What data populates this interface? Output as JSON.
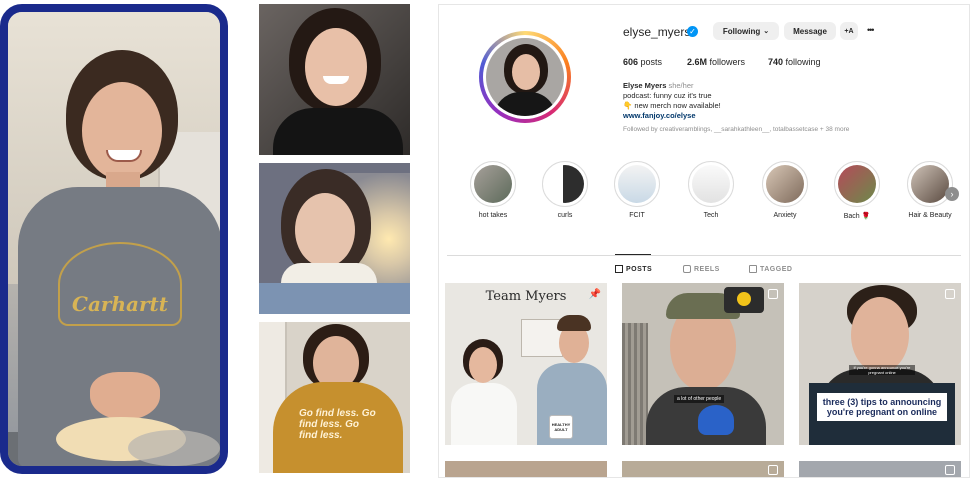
{
  "profile": {
    "username": "elyse_myers",
    "verified_icon": "verified-badge-icon",
    "following_label": "Following",
    "message_label": "Message",
    "add_person_glyph": "+A",
    "more_glyph": "•••",
    "posts_count": "606",
    "posts_label": "posts",
    "followers_count": "2.6M",
    "followers_label": "followers",
    "following_count": "740",
    "following_count_label": "following",
    "name": "Elyse Myers",
    "pronouns": "she/her",
    "bio_line1": "podcast: funny cuz it's true",
    "bio_line2": "👇 new merch now available!",
    "link": "www.fanjoy.co/elyse",
    "followed_by": "Followed by creativeramblings, __sarahkathleen__, totalbassetcase + 38 more"
  },
  "highlights": [
    {
      "label": "hot takes"
    },
    {
      "label": "curls"
    },
    {
      "label": "FCIT"
    },
    {
      "label": "Tech"
    },
    {
      "label": "Anxiety"
    },
    {
      "label": "Bach 🌹"
    },
    {
      "label": "Hair & Beauty"
    }
  ],
  "tabs": [
    {
      "label": "POSTS",
      "icon": "grid-icon",
      "active": true
    },
    {
      "label": "REELS",
      "icon": "reels-icon",
      "active": false
    },
    {
      "label": "TAGGED",
      "icon": "tagged-icon",
      "active": false
    }
  ],
  "posts": [
    {
      "caption": "Team Myers",
      "mug_text": "HEALTHY ADULT"
    },
    {
      "caption": "a lot of other people"
    },
    {
      "caption": "three (3) tips to announcing you're pregnant on online",
      "overlay_small": "if you're gonna announce you're pregnant online"
    }
  ],
  "left_photo": {
    "hoodie_text": "Carhartt"
  },
  "side_photo": {
    "hoodie_text": "Go find less. Go find less. Go find less."
  },
  "colors": {
    "frame": "#1a2a8c",
    "link": "#00376b",
    "verified": "#0095f6",
    "ring_start": "#feda75",
    "ring_end": "#d62976"
  }
}
